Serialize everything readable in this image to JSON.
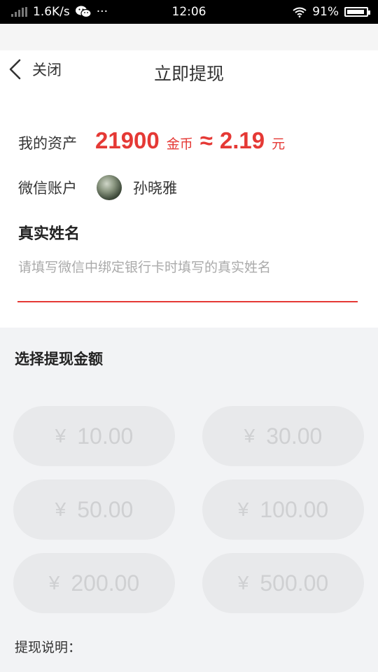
{
  "status_bar": {
    "network_speed": "1.6K/s",
    "dots": "···",
    "time": "12:06",
    "battery": "91%",
    "battery_level": 0.91,
    "icons": [
      "signal-icon",
      "wechat-icon",
      "wifi-icon",
      "battery-icon"
    ]
  },
  "header": {
    "close_label": "关闭",
    "title": "立即提现"
  },
  "assets": {
    "label": "我的资产",
    "coins": "21900",
    "coin_unit": "金币",
    "approx": "≈",
    "yuan": "2.19",
    "yuan_unit": "元"
  },
  "wechat": {
    "label": "微信账户",
    "name": "孙晓雅"
  },
  "real_name": {
    "label": "真实姓名",
    "placeholder": "请填写微信中绑定银行卡时填写的真实姓名",
    "value": ""
  },
  "amounts": {
    "title": "选择提现金额",
    "currency": "¥",
    "options": [
      "10.00",
      "30.00",
      "50.00",
      "100.00",
      "200.00",
      "500.00"
    ]
  },
  "description": {
    "label": "提现说明："
  },
  "colors": {
    "accent": "#e53935",
    "disabled_button": "#e8e9eb",
    "disabled_text": "#cfd0d2",
    "page_bg": "#f2f3f5"
  }
}
